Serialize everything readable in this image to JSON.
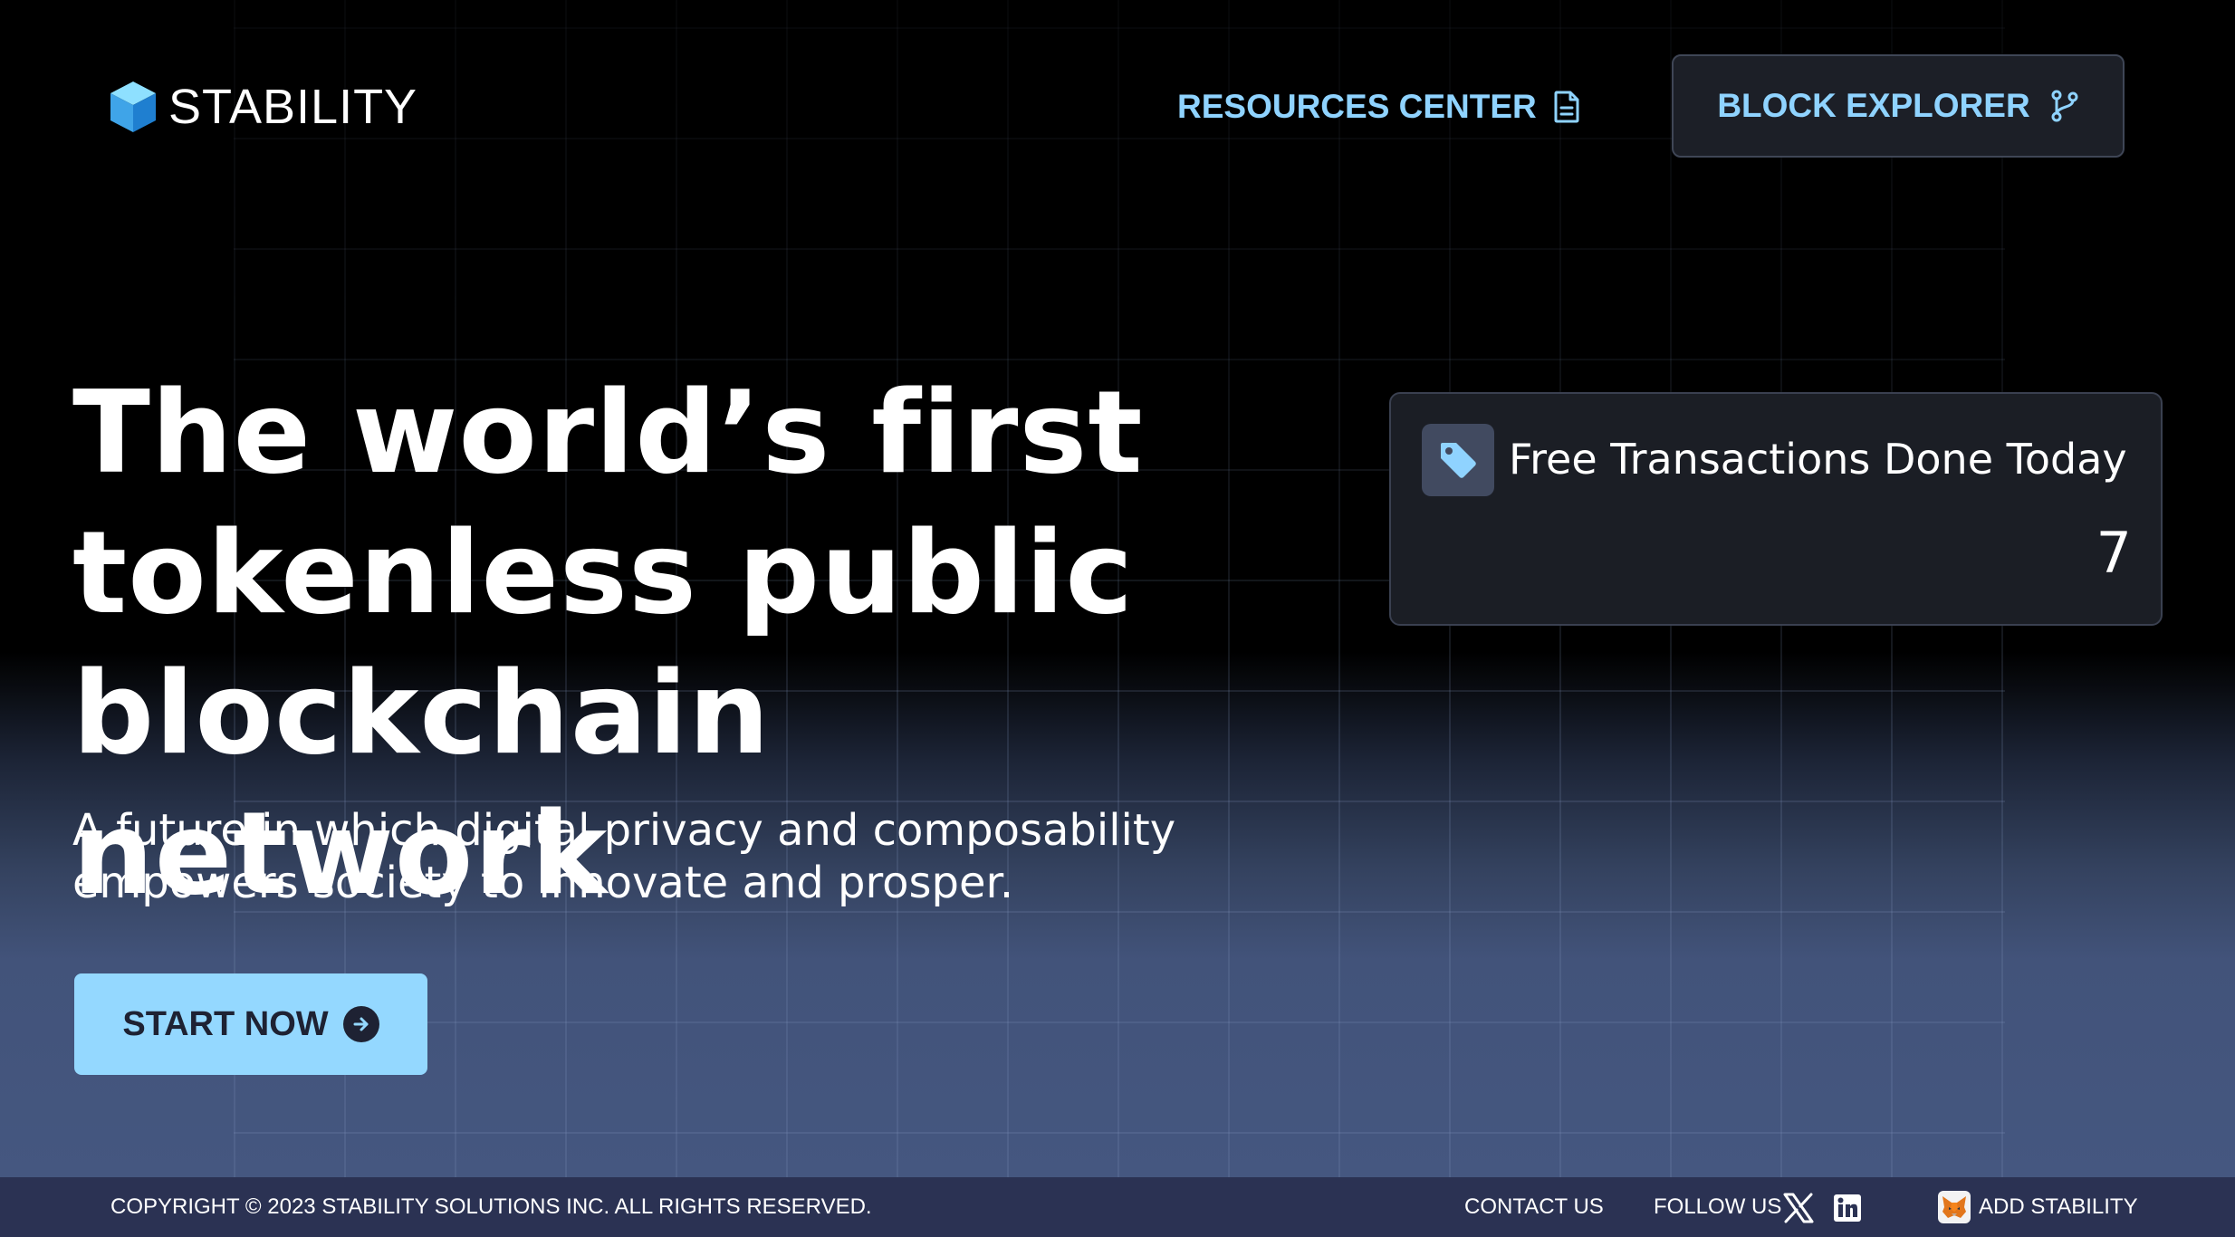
{
  "brand": {
    "name": "STABILITY"
  },
  "nav": {
    "resources_label": "RESOURCES CENTER",
    "explorer_label": "BLOCK EXPLORER"
  },
  "hero": {
    "title_lines": [
      "The world’s first",
      "tokenless public",
      "blockchain network"
    ],
    "subtitle_lines": [
      "A future in which digital privacy and composability",
      "empowers society to innovate and prosper."
    ],
    "cta_label": "START NOW"
  },
  "stat": {
    "label": "Free Transactions Done Today",
    "value": "7"
  },
  "footer": {
    "copyright": "COPYRIGHT © 2023 STABILITY SOLUTIONS INC. ALL RIGHTS RESERVED.",
    "contact_label": "CONTACT US",
    "follow_label": "FOLLOW US",
    "add_label": "ADD STABILITY"
  },
  "icons": {
    "logo": "cube-icon",
    "resources": "document-icon",
    "explorer": "git-branch-icon",
    "cta": "arrow-right-circle-icon",
    "stat": "tag-icon",
    "social_x": "x-icon",
    "social_linkedin": "linkedin-icon",
    "wallet": "metamask-fox-icon"
  },
  "colors": {
    "accent": "#8fd3ff",
    "cta_background": "#94d8ff",
    "footer_background": "#2b3253",
    "card_background": "#1b1e25"
  }
}
